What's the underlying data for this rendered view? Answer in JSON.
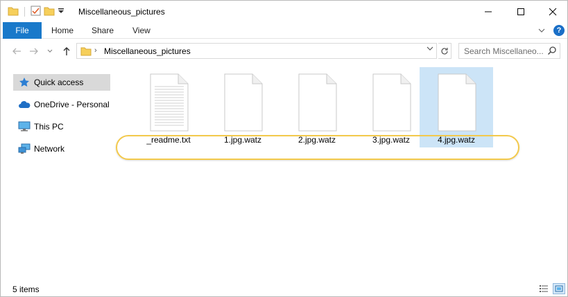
{
  "window": {
    "title": "Miscellaneous_pictures"
  },
  "window_controls": {
    "minimize": "—",
    "maximize": "☐",
    "close": "✕"
  },
  "ribbon": {
    "tabs": [
      "File",
      "Home",
      "Share",
      "View"
    ],
    "expand_glyph": "⌄",
    "help_glyph": "?"
  },
  "address_bar": {
    "path": "Miscellaneous_pictures",
    "chevron": "›",
    "dropdown_glyph": "⌄",
    "refresh_glyph": "↻",
    "search_placeholder": "Search Miscellaneo..."
  },
  "nav_buttons": {
    "back": "←",
    "forward": "→",
    "recent": "⌄",
    "up": "↑"
  },
  "nav_pane": {
    "items": [
      {
        "label": "Quick access",
        "icon": "star-icon",
        "selected": true
      },
      {
        "label": "OneDrive - Personal",
        "icon": "cloud-icon"
      },
      {
        "label": "This PC",
        "icon": "monitor-icon"
      },
      {
        "label": "Network",
        "icon": "network-icon"
      }
    ]
  },
  "files": [
    {
      "name": "_readme.txt",
      "icon": "text-document-icon",
      "selected": false
    },
    {
      "name": "1.jpg.watz",
      "icon": "blank-document-icon",
      "selected": false
    },
    {
      "name": "2.jpg.watz",
      "icon": "blank-document-icon",
      "selected": false
    },
    {
      "name": "3.jpg.watz",
      "icon": "blank-document-icon",
      "selected": false
    },
    {
      "name": "4.jpg.watz",
      "icon": "blank-document-icon",
      "selected": true
    }
  ],
  "status_bar": {
    "item_count": "5 items"
  },
  "colors": {
    "accent": "#1979ca",
    "selection": "#cce4f7",
    "highlight_oval": "#f3c94b"
  }
}
